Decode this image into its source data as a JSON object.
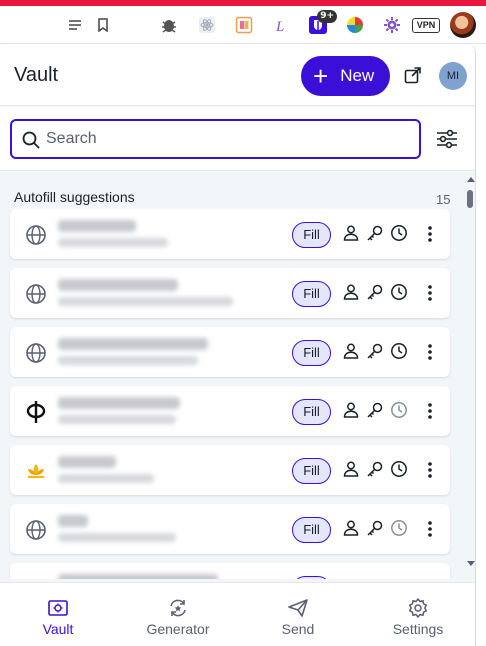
{
  "browser": {
    "extension_badge": "9+",
    "vpn_label": "VPN"
  },
  "header": {
    "title": "Vault",
    "new_button": "New",
    "avatar_initials": "MI"
  },
  "search": {
    "placeholder": "Search"
  },
  "autofill": {
    "heading": "Autofill suggestions",
    "count": "15",
    "fill_label": "Fill",
    "items": [
      {
        "icon": "globe-icon"
      },
      {
        "icon": "globe-icon"
      },
      {
        "icon": "globe-icon"
      },
      {
        "icon": "phi-logo-icon"
      },
      {
        "icon": "flower-logo-icon"
      },
      {
        "icon": "globe-icon"
      },
      {
        "icon": "globe-icon"
      }
    ]
  },
  "nav": {
    "vault": "Vault",
    "generator": "Generator",
    "send": "Send",
    "settings": "Settings"
  },
  "colors": {
    "accent": "#3b0fd8",
    "fill_bg": "#e4e6fb",
    "list_bg": "#f3f6f9",
    "browser_red": "#e8173f"
  }
}
